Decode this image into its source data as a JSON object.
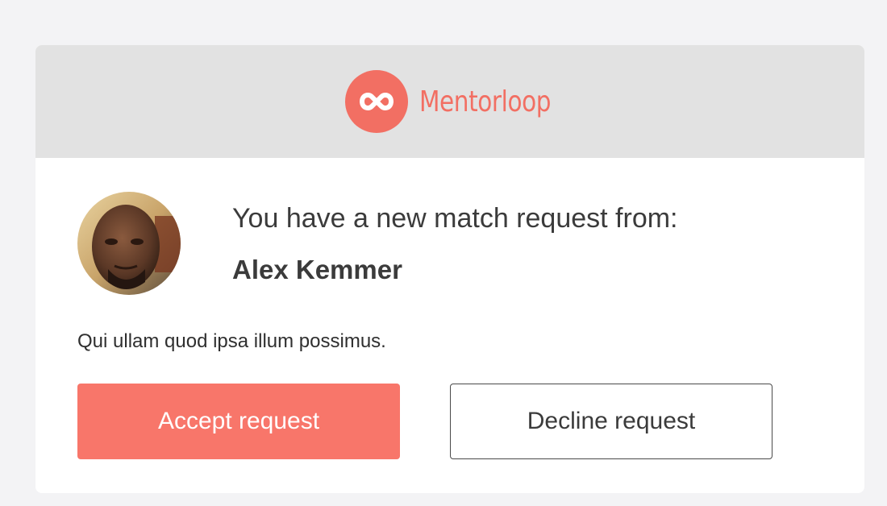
{
  "brand": {
    "name": "Mentorloop",
    "color": "#f26f63",
    "icon": "infinity-loop-icon"
  },
  "request": {
    "intro": "You have a new match request from:",
    "requester_name": "Alex Kemmer",
    "message": "Qui ullam quod ipsa illum possimus."
  },
  "actions": {
    "accept_label": "Accept request",
    "decline_label": "Decline request",
    "accept_color": "#f8766a"
  },
  "colors": {
    "page_bg": "#f3f3f5",
    "header_bg": "#e2e2e2",
    "text": "#3b3b3b"
  }
}
